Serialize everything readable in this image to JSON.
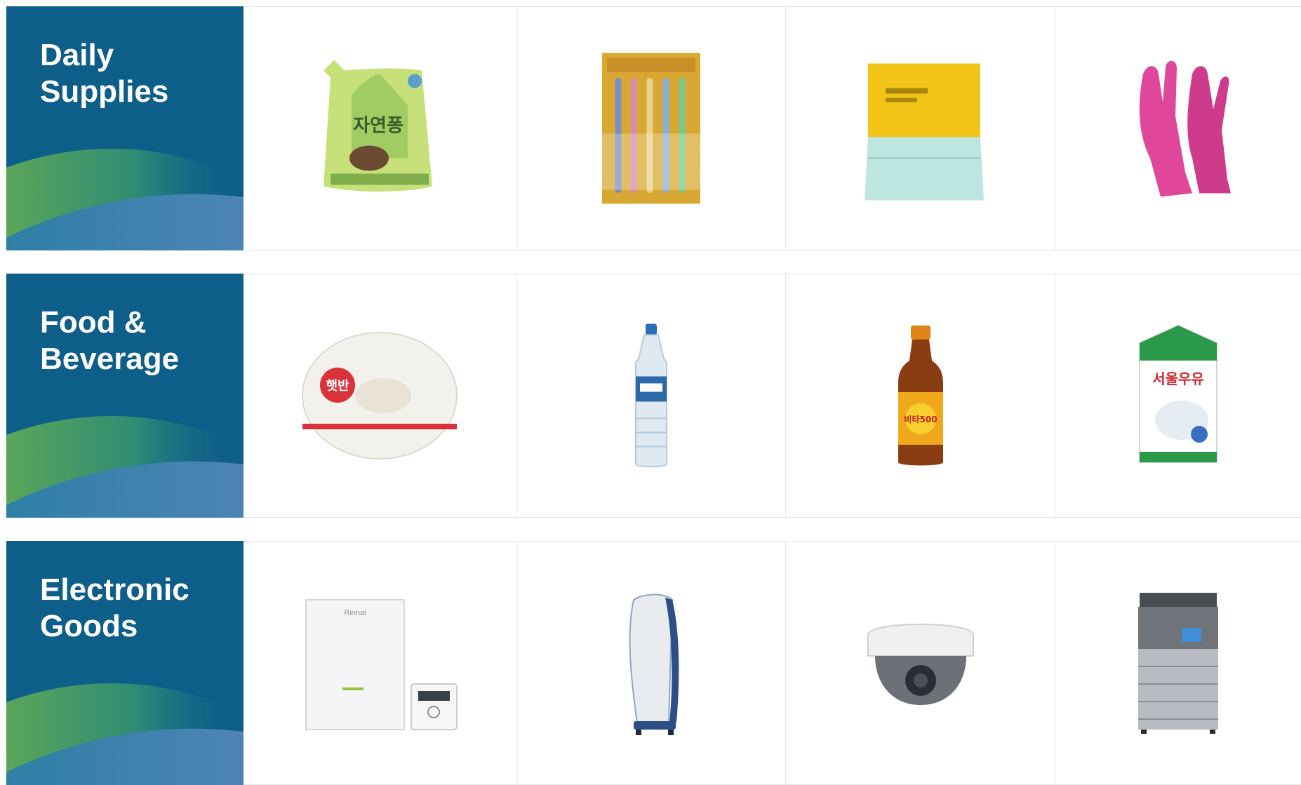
{
  "colors": {
    "category_bg": "#0e5e8a",
    "wave_green": "#5aa65a",
    "wave_blue": "#3d86b8",
    "grid_line": "#e4e4e4"
  },
  "categories": [
    {
      "title_line1": "Daily",
      "title_line2": "Supplies",
      "products": [
        {
          "icon": "dish-soap-pouch-icon",
          "label": "자연퐁"
        },
        {
          "icon": "toothbrush-pack-icon",
          "label": ""
        },
        {
          "icon": "scrub-cloth-pack-icon",
          "label": ""
        },
        {
          "icon": "rubber-gloves-icon",
          "label": ""
        }
      ]
    },
    {
      "title_line1": "Food &",
      "title_line2": "Beverage",
      "products": [
        {
          "icon": "instant-rice-bowl-icon",
          "label": "햇반"
        },
        {
          "icon": "water-bottle-icon",
          "label": ""
        },
        {
          "icon": "vitamin-drink-bottle-icon",
          "label": "비타500"
        },
        {
          "icon": "milk-carton-icon",
          "label": "서울우유"
        }
      ]
    },
    {
      "title_line1": "Electronic",
      "title_line2": "Goods",
      "products": [
        {
          "icon": "boiler-unit-icon",
          "label": "Rinnai"
        },
        {
          "icon": "air-purifier-tower-icon",
          "label": ""
        },
        {
          "icon": "dome-security-camera-icon",
          "label": ""
        },
        {
          "icon": "multifunction-printer-icon",
          "label": ""
        }
      ]
    }
  ]
}
